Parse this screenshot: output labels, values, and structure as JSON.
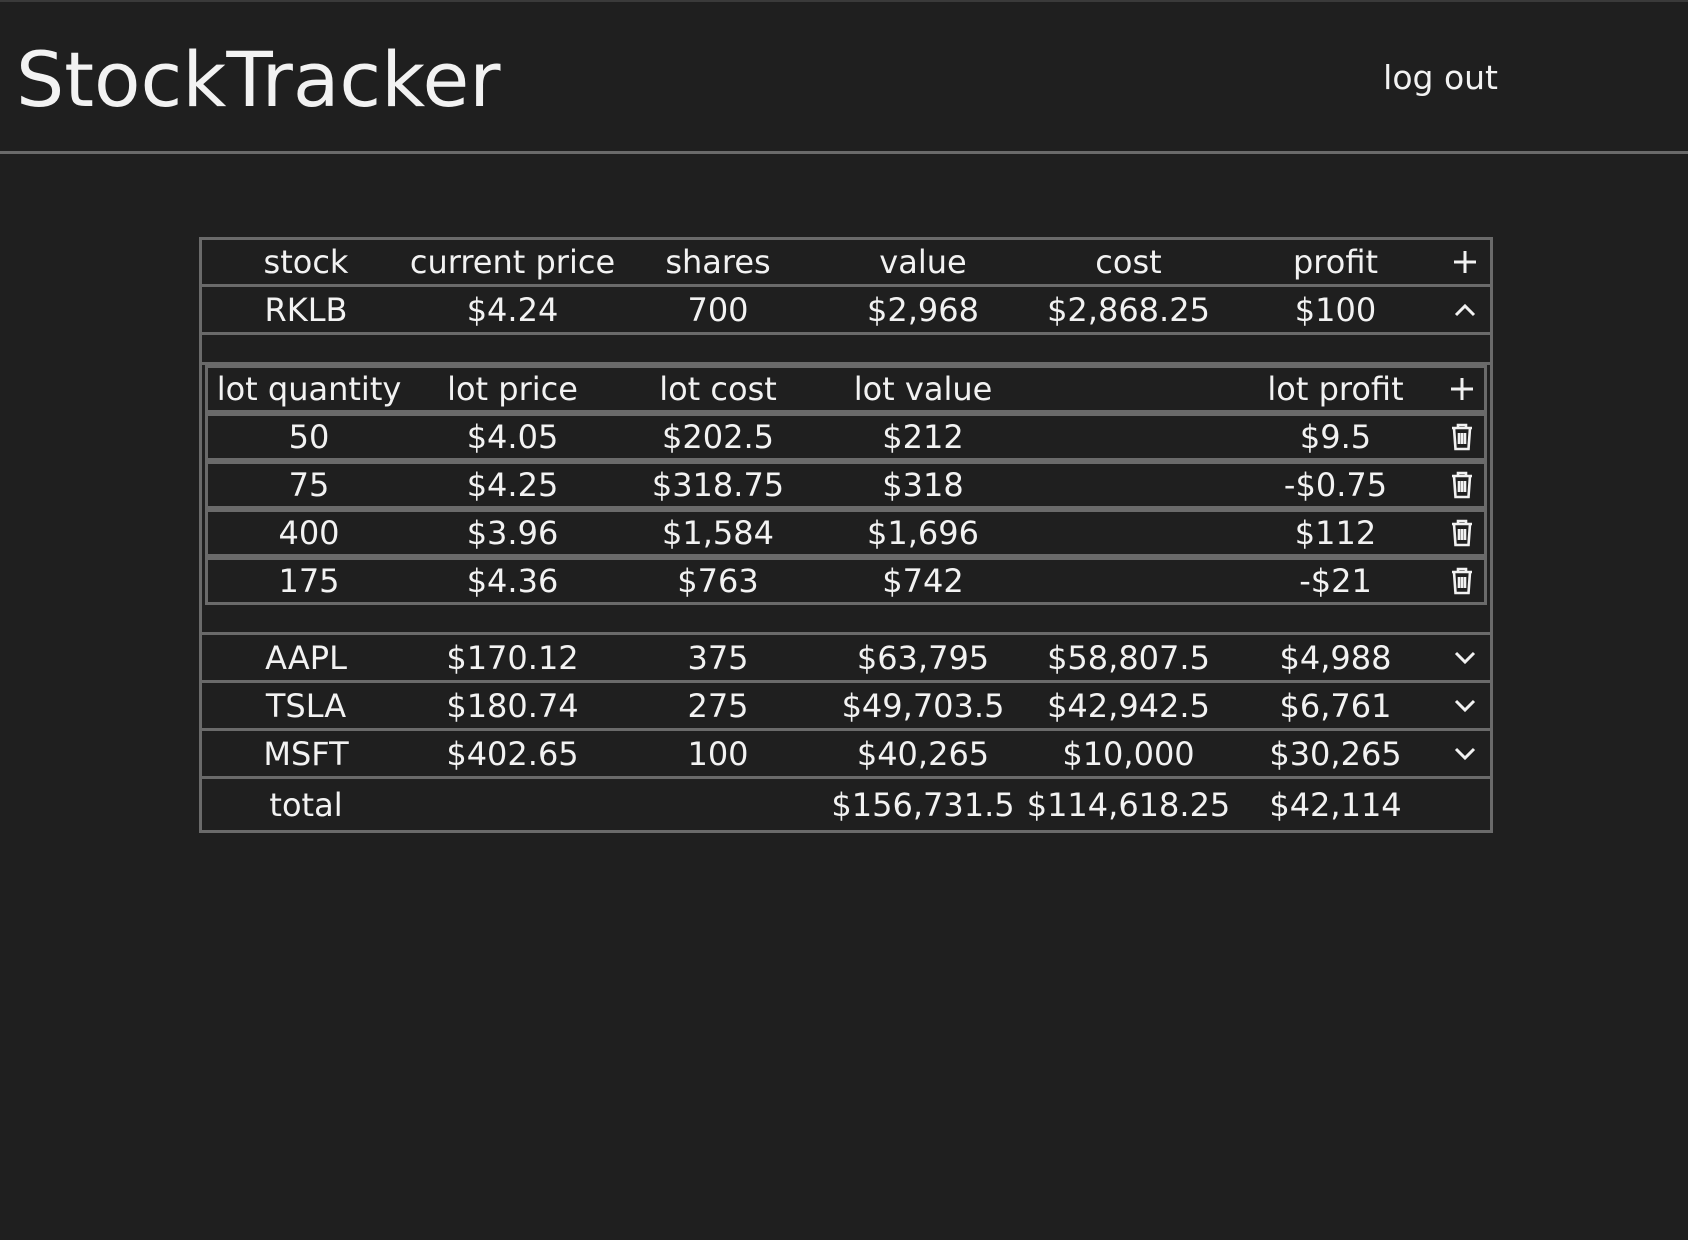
{
  "header": {
    "title": "StockTracker",
    "logout_label": "log out"
  },
  "table": {
    "headers": [
      "stock",
      "current price",
      "shares",
      "value",
      "cost",
      "profit"
    ],
    "add_icon": "plus-icon",
    "stocks": [
      {
        "symbol": "RKLB",
        "price": "$4.24",
        "shares": "700",
        "value": "$2,968",
        "cost": "$2,868.25",
        "profit": "$100",
        "expanded": true,
        "toggle_icon": "chevron-up-icon"
      },
      {
        "symbol": "AAPL",
        "price": "$170.12",
        "shares": "375",
        "value": "$63,795",
        "cost": "$58,807.5",
        "profit": "$4,988",
        "expanded": false,
        "toggle_icon": "chevron-down-icon"
      },
      {
        "symbol": "TSLA",
        "price": "$180.74",
        "shares": "275",
        "value": "$49,703.5",
        "cost": "$42,942.5",
        "profit": "$6,761",
        "expanded": false,
        "toggle_icon": "chevron-down-icon"
      },
      {
        "symbol": "MSFT",
        "price": "$402.65",
        "shares": "100",
        "value": "$40,265",
        "cost": "$10,000",
        "profit": "$30,265",
        "expanded": false,
        "toggle_icon": "chevron-down-icon"
      }
    ],
    "lots": {
      "headers": [
        "lot quantity",
        "lot price",
        "lot cost",
        "lot value",
        "lot profit"
      ],
      "add_icon": "plus-icon",
      "rows": [
        {
          "quantity": "50",
          "price": "$4.05",
          "cost": "$202.5",
          "value": "$212",
          "profit": "$9.5",
          "icon": "trash-icon"
        },
        {
          "quantity": "75",
          "price": "$4.25",
          "cost": "$318.75",
          "value": "$318",
          "profit": "-$0.75",
          "icon": "trash-icon"
        },
        {
          "quantity": "400",
          "price": "$3.96",
          "cost": "$1,584",
          "value": "$1,696",
          "profit": "$112",
          "icon": "trash-icon"
        },
        {
          "quantity": "175",
          "price": "$4.36",
          "cost": "$763",
          "value": "$742",
          "profit": "-$21",
          "icon": "trash-icon"
        }
      ]
    },
    "total": {
      "label": "total",
      "value": "$156,731.5",
      "cost": "$114,618.25",
      "profit": "$42,114"
    }
  },
  "colors": {
    "background": "#1f1f1f",
    "text": "#f2f2f2",
    "border": "#6a6a6a"
  }
}
